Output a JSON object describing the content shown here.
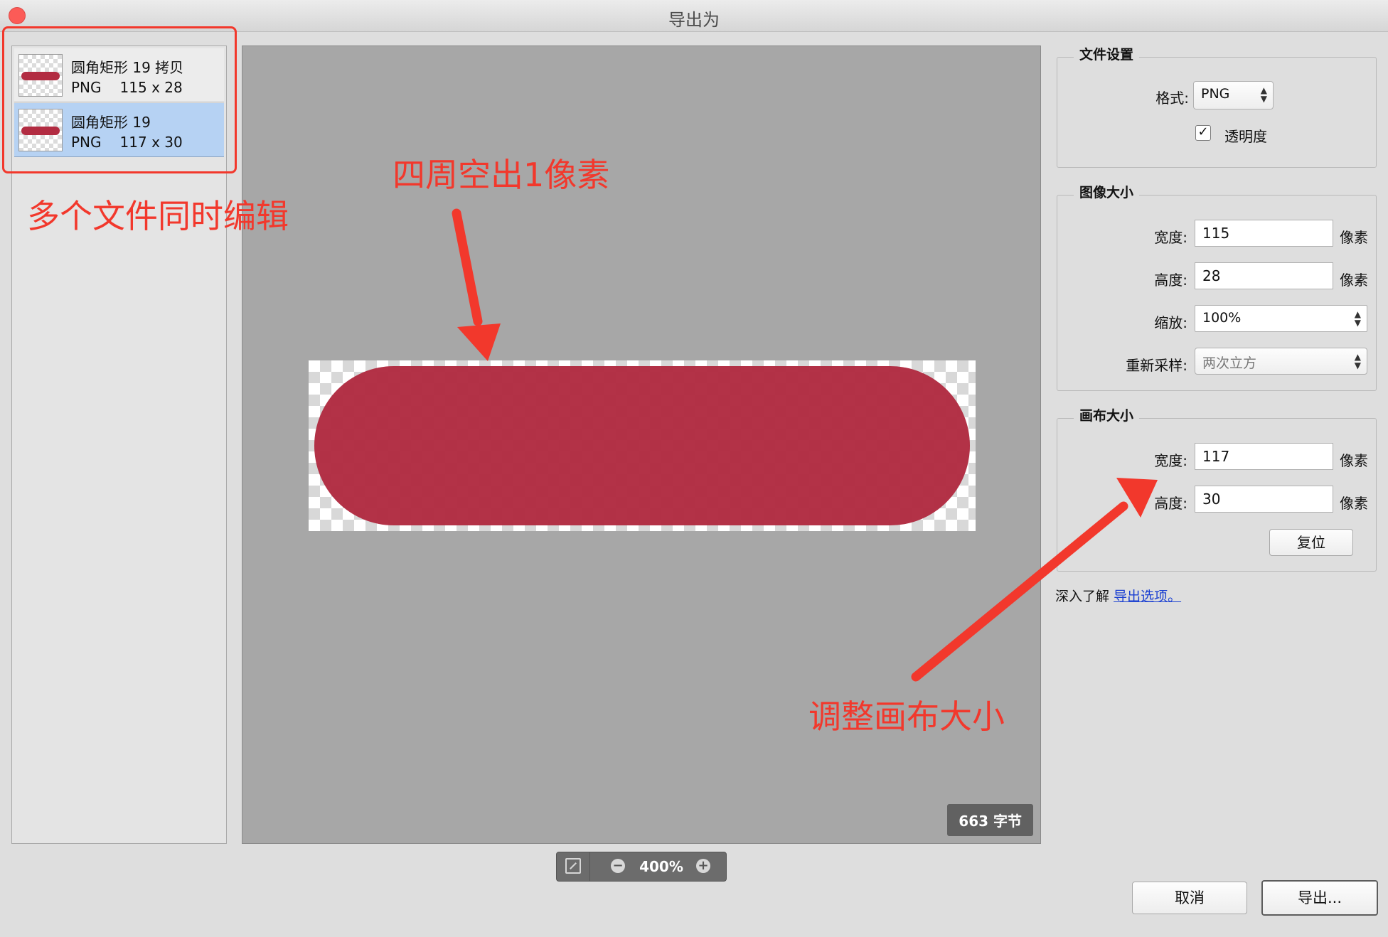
{
  "window": {
    "title": "导出为"
  },
  "files": [
    {
      "name": "圆角矩形 19 拷贝",
      "format": "PNG",
      "dims": "115 x 28"
    },
    {
      "name": "圆角矩形 19",
      "format": "PNG",
      "dims": "117 x 30"
    }
  ],
  "preview": {
    "size_badge": "663 字节",
    "zoom": "400%"
  },
  "file_settings": {
    "title": "文件设置",
    "format_label": "格式:",
    "format_value": "PNG",
    "transparency_label": "透明度",
    "transparency_checked": true,
    "check_glyph": "✓"
  },
  "image_size": {
    "title": "图像大小",
    "width_label": "宽度:",
    "width_value": "115",
    "height_label": "高度:",
    "height_value": "28",
    "scale_label": "缩放:",
    "scale_value": "100%",
    "resample_label": "重新采样:",
    "resample_value": "两次立方",
    "unit": "像素"
  },
  "canvas_size": {
    "title": "画布大小",
    "width_label": "宽度:",
    "width_value": "117",
    "height_label": "高度:",
    "height_value": "30",
    "unit": "像素",
    "reset_label": "复位"
  },
  "help": {
    "prefix": "深入了解",
    "link": "导出选项。"
  },
  "footer": {
    "cancel_label": "取消",
    "export_label": "导出..."
  },
  "annotations": {
    "multi_edit": "多个文件同时编辑",
    "padding": "四周空出1像素",
    "adjust_canvas": "调整画布大小"
  },
  "colors": {
    "annotation": "#f2382c",
    "shape_fill": "#b02a40",
    "selection": "#b6d2f3",
    "link": "#1a3fd1"
  },
  "icons": {
    "zoom_minus": "−",
    "zoom_plus": "+",
    "stepper_up": "▲",
    "stepper_down": "▼"
  }
}
